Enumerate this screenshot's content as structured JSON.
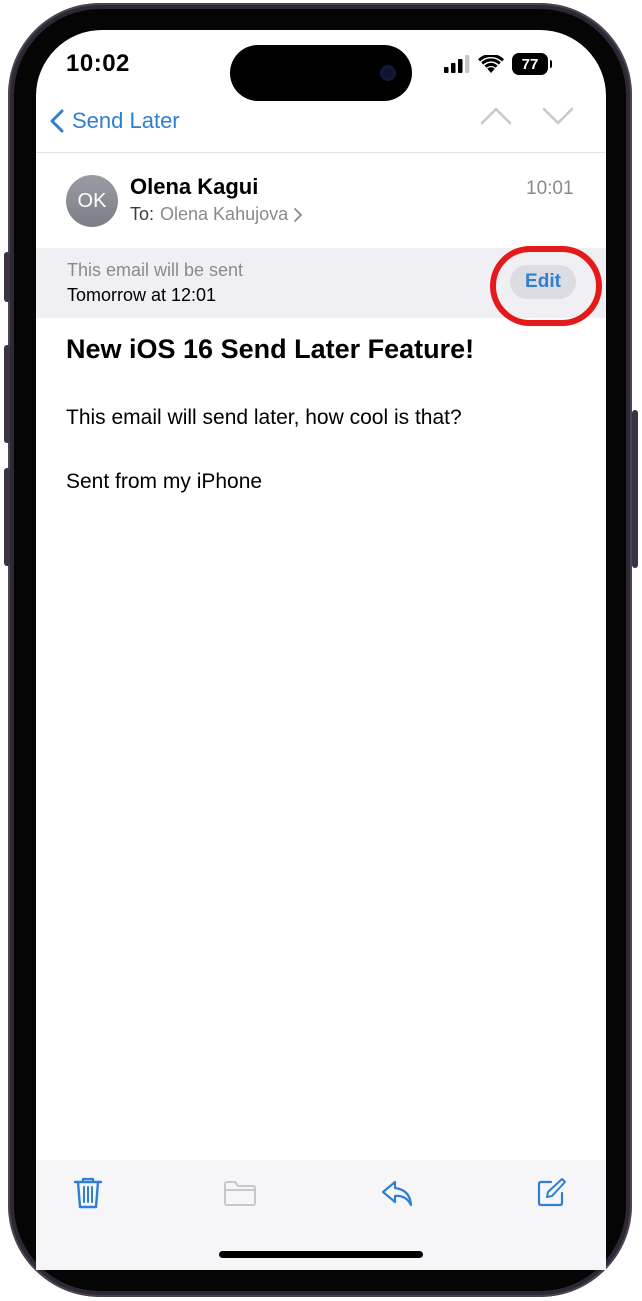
{
  "status_bar": {
    "time": "10:02",
    "battery": "77"
  },
  "nav": {
    "back_label": "Send Later"
  },
  "message": {
    "avatar_initials": "OK",
    "sender": "Olena Kagui",
    "to_label": "To:",
    "recipient": "Olena Kahujova",
    "time": "10:01",
    "subject": "New iOS 16 Send Later Feature!",
    "body_line_1": "This email will send later, how cool is that?",
    "body_line_2": "Sent from my iPhone"
  },
  "send_banner": {
    "subtitle": "This email will be sent",
    "schedule": "Tomorrow at 12:01",
    "edit_label": "Edit"
  },
  "toolbar": {
    "icons": [
      "trash-icon",
      "folder-icon",
      "reply-icon",
      "compose-icon"
    ]
  },
  "colors": {
    "accent": "#2f7fd3",
    "highlight": "#e41a1a",
    "banner": "#efeff4"
  }
}
